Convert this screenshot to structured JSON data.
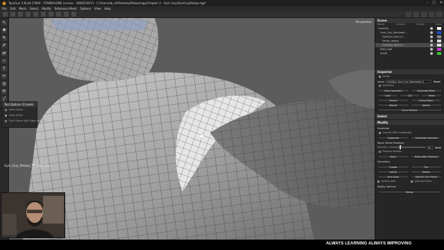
{
  "window": {
    "title": "TopoGun 3 Build 27840 - STANDALONE License - 3806219073 - C:/Users/ab_x0/Desktop/Retopology/Chapter 2 - Gym Guy/GymGuyRetopo.tgp*",
    "app_icon": "topogun-logo"
  },
  "menu": [
    "File",
    "Edit",
    "Mesh",
    "Select",
    "Modify",
    "Reference Mesh",
    "Options",
    "View",
    "Help"
  ],
  "viewport": {
    "camera_label": "Perspective"
  },
  "tool_options": {
    "title": "Tool Options (Create)",
    "options": [
      "Make Faces",
      "Auto Select",
      "Don't Move Split Edge Vertices"
    ]
  },
  "overlay_text": "Gym_Guy_Retopo_TR_High_Ret...",
  "banner": "ALWAYS LEARNING ALWAYS IMPROVING",
  "scene_panel": {
    "title": "Scene",
    "col_name": "Name",
    "col_current": "Current",
    "col_visible": "Visible",
    "col_color": "Color",
    "rows": [
      {
        "label": "GymGuy",
        "color": "#ffffff"
      },
      {
        "label": "Gym_Guy_Decimate...",
        "color": "#1d4fd1"
      },
      {
        "label": "GymGuy_Sym_G...",
        "color": "#8a8a8a"
      },
      {
        "label": "EarHp_retopo",
        "color": "#d9d9d9"
      },
      {
        "label": "GymGuy_Sym_G...",
        "color": "#e2e2e2"
      },
      {
        "label": "Nike_high",
        "color": "#c23bd6"
      },
      {
        "label": "Shell?",
        "color": "#35c72f"
      }
    ]
  },
  "inspector": {
    "title": "Inspector",
    "visible_label": "Visible",
    "name_label": "Name",
    "name_value": "GymGuy_Sym_Guy_Decimated_2",
    "reset_label": "Reset",
    "symmetry_label": "Symmetry",
    "buttons": [
      [
        "Clear Geometry",
        "Duplicate Mesh"
      ],
      [
        "Copy",
        "Cut",
        "Paste"
      ],
      [
        "Export",
        "Export Back"
      ],
      [
        "Reload",
        "Delete"
      ],
      [
        "Force Refresh"
      ]
    ]
  },
  "select_section": "Select",
  "modify": {
    "title": "Modify",
    "subdivide_title": "Subdivide",
    "subdivide_option": "Connect With Undetected",
    "subdivide_buttons": [
      "Subdivide",
      "Subdivide Selected"
    ],
    "relax_title": "Relax Vertex Positions",
    "intensity_label": "Intensity",
    "intensity_value": "30",
    "reset_label": "Reset",
    "preserve_borders": "Preserve Borders",
    "relax_buttons": [
      "Relax",
      "Relax With Selected"
    ],
    "symmetry_title": "Symmetry",
    "sym_buttons": [
      [
        "Create",
        "Flip"
      ],
      [
        "Adjust",
        "Delete"
      ],
      [
        "Zero Snap",
        "Split By Sym Plane"
      ]
    ],
    "confirm_label": "Confirm after",
    "split_plane_label": "Split Face Plane",
    "modify_vertices": "Modify Vertices",
    "merge_label": "Merge"
  }
}
